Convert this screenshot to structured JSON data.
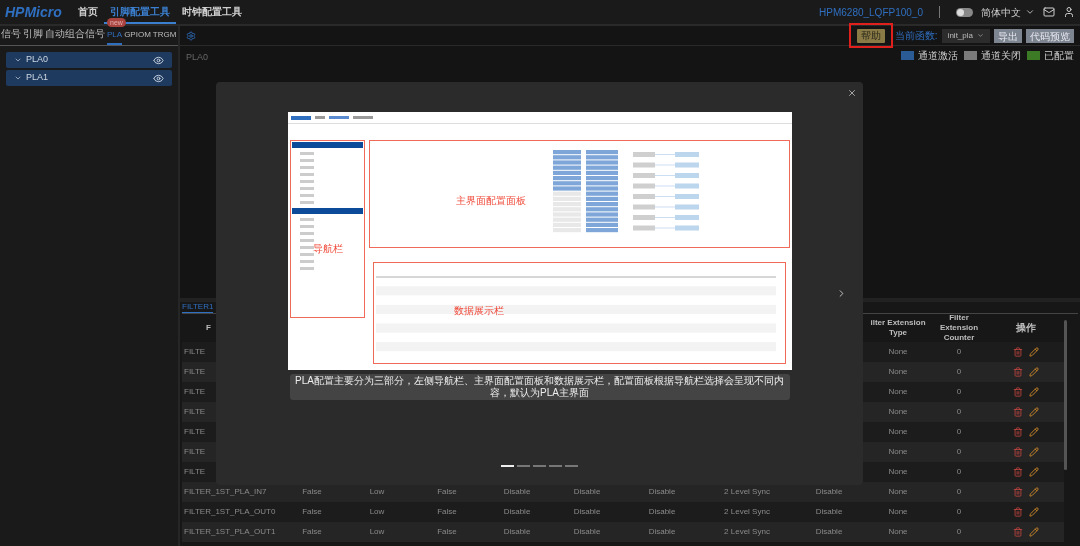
{
  "top_bar": {
    "logo": "HPMicro",
    "nav": [
      {
        "label": "首页",
        "selected": false
      },
      {
        "label": "引脚配置工具",
        "selected": true
      },
      {
        "label": "时钟配置工具",
        "selected": false
      }
    ],
    "device": "HPM6280_LQFP100_0",
    "theme_toggle": {
      "on": false
    },
    "language": "简体中文"
  },
  "left_panel": {
    "tabs": [
      {
        "label": "信号",
        "selected": false
      },
      {
        "label": "引脚",
        "selected": false
      },
      {
        "label": "自动组合信号",
        "selected": false
      },
      {
        "label": "PLA",
        "selected": true,
        "badge": "new"
      },
      {
        "label": "GPIOM",
        "selected": false
      },
      {
        "label": "TRGM",
        "selected": false
      }
    ],
    "items": [
      {
        "label": "PLA0"
      },
      {
        "label": "PLA1"
      }
    ]
  },
  "toolbar": {
    "help_button": {
      "label": "帮助",
      "highlighted": true
    },
    "function_label": "当前函数:",
    "function_select": "init_pla",
    "buttons": [
      "导出",
      "代码预览"
    ]
  },
  "legend": [
    {
      "label": "通道激活",
      "color": "#2a5b95"
    },
    {
      "label": "通道关闭",
      "color": "#7a7a7a"
    },
    {
      "label": "已配置",
      "color": "#3c7a26"
    }
  ],
  "canvas": {
    "title": "PLA0"
  },
  "bottom": {
    "tabs": [
      {
        "label": "FILTER1",
        "selected": true
      }
    ],
    "columns": [
      {
        "kind": "channel",
        "label": "F"
      },
      {
        "kind": "extension_type",
        "label": "ilter Extension Type"
      },
      {
        "kind": "extension_counter",
        "label": "Filter Extension Counter"
      },
      {
        "kind": "actions",
        "label": "操作"
      }
    ],
    "rows": [
      {
        "channel": "FILTE",
        "extension_type": "None",
        "extension_counter": "0"
      },
      {
        "channel": "FILTE",
        "extension_type": "None",
        "extension_counter": "0"
      },
      {
        "channel": "FILTE",
        "extension_type": "None",
        "extension_counter": "0"
      },
      {
        "channel": "FILTE",
        "extension_type": "None",
        "extension_counter": "0"
      },
      {
        "channel": "FILTE",
        "extension_type": "None",
        "extension_counter": "0"
      },
      {
        "channel": "FILTE",
        "extension_type": "None",
        "extension_counter": "0"
      },
      {
        "channel": "FILTE",
        "extension_type": "None",
        "extension_counter": "0"
      },
      {
        "channel": "FILTER_1ST_PLA_IN7",
        "values": [
          "False",
          "Low",
          "False",
          "Disable",
          "Disable",
          "Disable",
          "2 Level Sync",
          "Disable"
        ],
        "extension_type": "None",
        "extension_counter": "0"
      },
      {
        "channel": "FILTER_1ST_PLA_OUT0",
        "values": [
          "False",
          "Low",
          "False",
          "Disable",
          "Disable",
          "Disable",
          "2 Level Sync",
          "Disable"
        ],
        "extension_type": "None",
        "extension_counter": "0"
      },
      {
        "channel": "FILTER_1ST_PLA_OUT1",
        "values": [
          "False",
          "Low",
          "False",
          "Disable",
          "Disable",
          "Disable",
          "2 Level Sync",
          "Disable"
        ],
        "extension_type": "None",
        "extension_counter": "0"
      }
    ]
  },
  "modal": {
    "annotations": [
      "导航栏",
      "主界面配置面板",
      "数据展示栏"
    ],
    "caption": "PLA配置主要分为三部分，左侧导航栏、主界面配置面板和数据展示栏，配置面板根据导航栏选择会呈现不同内容，默认为PLA主界面",
    "pages": [
      {
        "selected": true
      },
      {
        "selected": false
      },
      {
        "selected": false
      },
      {
        "selected": false
      },
      {
        "selected": false
      }
    ]
  }
}
